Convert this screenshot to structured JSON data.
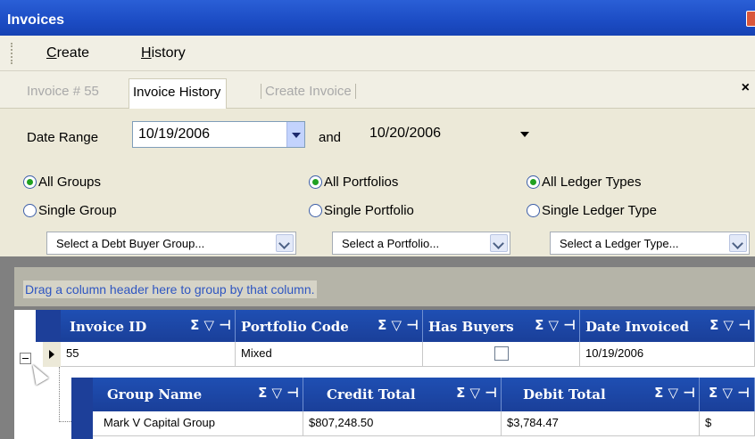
{
  "window": {
    "title": "Invoices"
  },
  "menu": {
    "items": [
      "Create",
      "History"
    ]
  },
  "tabs": [
    {
      "label": "Invoice # 55",
      "state": "disabled"
    },
    {
      "label": "Invoice History",
      "state": "active"
    },
    {
      "label": "Create Invoice",
      "state": "disabled"
    }
  ],
  "date_range": {
    "label": "Date Range",
    "from": "10/19/2006",
    "and_label": "and",
    "to": "10/20/2006"
  },
  "groups": {
    "all": "All Groups",
    "single": "Single Group",
    "select_placeholder": "Select a Debt Buyer Group..."
  },
  "portfolios": {
    "all": "All Portfolios",
    "single": "Single Portfolio",
    "select_placeholder": "Select a Portfolio..."
  },
  "ledger": {
    "all": "All Ledger Types",
    "single": "Single Ledger Type",
    "select_placeholder": "Select a Ledger Type..."
  },
  "grid": {
    "group_hint": "Drag a column header here to group by that column.",
    "header_icons": "Σ ▽ ⊣",
    "columns": [
      "Invoice ID",
      "Portfolio Code",
      "Has Buyers",
      "Date Invoiced"
    ],
    "rows": [
      {
        "invoice_id": "55",
        "portfolio_code": "Mixed",
        "has_buyers": false,
        "date_invoiced": "10/19/2006"
      }
    ],
    "child": {
      "columns": [
        "Group Name",
        "Credit Total",
        "Debit Total",
        ""
      ],
      "rows": [
        {
          "group_name": "Mark V Capital Group",
          "credit_total": "$807,248.50",
          "debit_total": "$3,784.47",
          "extra": "$"
        }
      ]
    }
  },
  "colors": {
    "title_bar": "#1c4cc4",
    "grid_header": "#1f4fb3",
    "hint_text": "#2f56c1",
    "radio_checked": "#21a121"
  }
}
